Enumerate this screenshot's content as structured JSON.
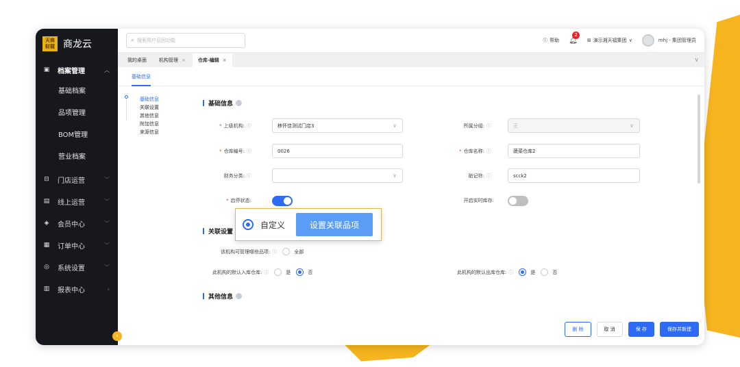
{
  "brand": {
    "logo_line1": "天商",
    "logo_line2": "财龍",
    "name": "商龙云"
  },
  "sidebar": {
    "groups": [
      {
        "label": "档案管理",
        "icon": "archive-icon",
        "expanded": true,
        "children": [
          "基础档案",
          "品项管理",
          "BOM管理",
          "营业档案"
        ]
      },
      {
        "label": "门店运营",
        "icon": "store-icon"
      },
      {
        "label": "线上运营",
        "icon": "online-icon"
      },
      {
        "label": "会员中心",
        "icon": "member-icon"
      },
      {
        "label": "订单中心",
        "icon": "order-icon"
      },
      {
        "label": "系统设置",
        "icon": "settings-icon"
      },
      {
        "label": "报表中心",
        "icon": "report-icon"
      }
    ]
  },
  "topbar": {
    "search_placeholder": "搜索用户后回功能",
    "help": "帮助",
    "notifications": "2",
    "org": "演示湘天福集团",
    "user": "mhj - 集团管理员"
  },
  "tabs": [
    {
      "label": "我的桌面",
      "closable": false,
      "active": false
    },
    {
      "label": "机构管理",
      "closable": true,
      "active": false
    },
    {
      "label": "仓库-编辑",
      "closable": true,
      "active": true
    }
  ],
  "subtab": "基础信息",
  "anchors": [
    {
      "label": "基础信息",
      "active": true
    },
    {
      "label": "关联设置",
      "active": false
    },
    {
      "label": "其他信息",
      "active": false
    },
    {
      "label": "附加信息",
      "active": false
    },
    {
      "label": "来源信息",
      "active": false
    }
  ],
  "sections": {
    "basic": "基础信息",
    "relation": "关联设置",
    "other": "其他信息"
  },
  "form": {
    "parent_org": {
      "label": "上级机构:",
      "value": "移怀佳测试门店3"
    },
    "group": {
      "label": "所属分组:",
      "value": "无"
    },
    "code": {
      "label": "仓库编号:",
      "value": "0026"
    },
    "name": {
      "label": "仓库名称:",
      "value": "蔬菜仓库2"
    },
    "finance": {
      "label": "财务分类:",
      "value": ""
    },
    "mnemonic": {
      "label": "助记符:",
      "value": "scck2"
    },
    "enabled": {
      "label": "启停状态:",
      "on": true
    },
    "realtime": {
      "label": "开启实时库存:",
      "on": false
    },
    "manage_items": {
      "label": "该机构可管理哪些品项:",
      "option_all": "全部"
    },
    "default_in": {
      "label": "此机构的默认入库仓库:",
      "yes": "是",
      "no": "否",
      "selected": "否"
    },
    "default_out": {
      "label": "此机构的默认出库仓库:",
      "yes": "是",
      "no": "否",
      "selected": "是"
    }
  },
  "popup": {
    "custom_label": "自定义",
    "button": "设置关联品项"
  },
  "footer": {
    "delete": "删 除",
    "cancel": "取 消",
    "save": "保 存",
    "save_new": "保存并新建"
  },
  "colors": {
    "accent": "#2d6bf5",
    "brand_yellow": "#f6b51e",
    "sidebar_bg": "#16181d"
  }
}
